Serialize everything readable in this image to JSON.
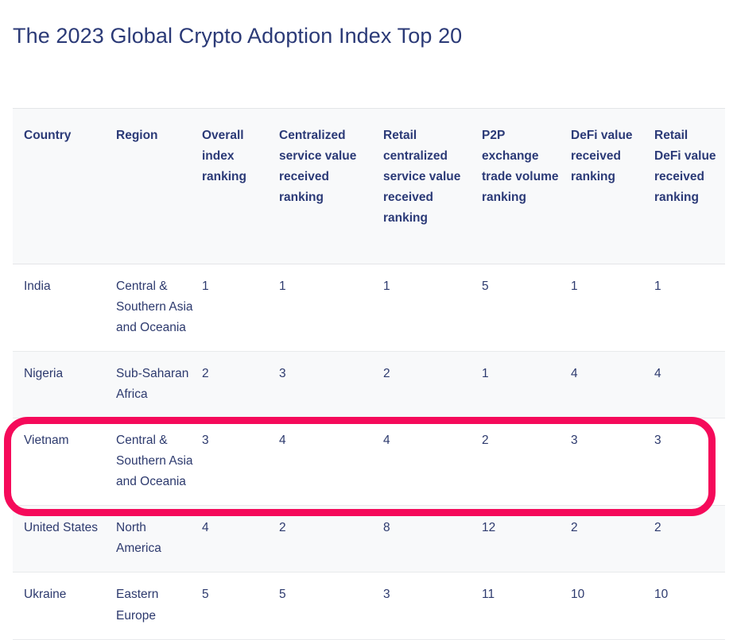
{
  "title": "The 2023 Global Crypto Adoption Index Top 20",
  "table": {
    "headers": [
      "Country",
      "Region",
      "Overall index ranking",
      "Centralized service value received ranking",
      "Retail centralized service value received ranking",
      "P2P exchange trade volume ranking",
      "DeFi value received ranking",
      "Retail DeFi value received ranking"
    ],
    "rows": [
      {
        "country": "India",
        "region": "Central & Southern Asia and Oceania",
        "overall": "1",
        "centralized": "1",
        "retail_centralized": "1",
        "p2p": "5",
        "defi": "1",
        "retail_defi": "1"
      },
      {
        "country": "Nigeria",
        "region": "Sub-Saharan Africa",
        "overall": "2",
        "centralized": "3",
        "retail_centralized": "2",
        "p2p": "1",
        "defi": "4",
        "retail_defi": "4"
      },
      {
        "country": "Vietnam",
        "region": "Central & Southern Asia and Oceania",
        "overall": "3",
        "centralized": "4",
        "retail_centralized": "4",
        "p2p": "2",
        "defi": "3",
        "retail_defi": "3"
      },
      {
        "country": "United States",
        "region": "North America",
        "overall": "4",
        "centralized": "2",
        "retail_centralized": "8",
        "p2p": "12",
        "defi": "2",
        "retail_defi": "2"
      },
      {
        "country": "Ukraine",
        "region": "Eastern Europe",
        "overall": "5",
        "centralized": "5",
        "retail_centralized": "3",
        "p2p": "11",
        "defi": "10",
        "retail_defi": "10"
      }
    ]
  },
  "annotation": {
    "highlight_row_country": "Vietnam",
    "highlight_color": "#f50a5a"
  },
  "colors": {
    "text": "#2d3a6e",
    "title": "#2b3a77",
    "header_background": "#f8f9fa",
    "row_divider": "#e8eaec",
    "page_background": "#ffffff"
  }
}
